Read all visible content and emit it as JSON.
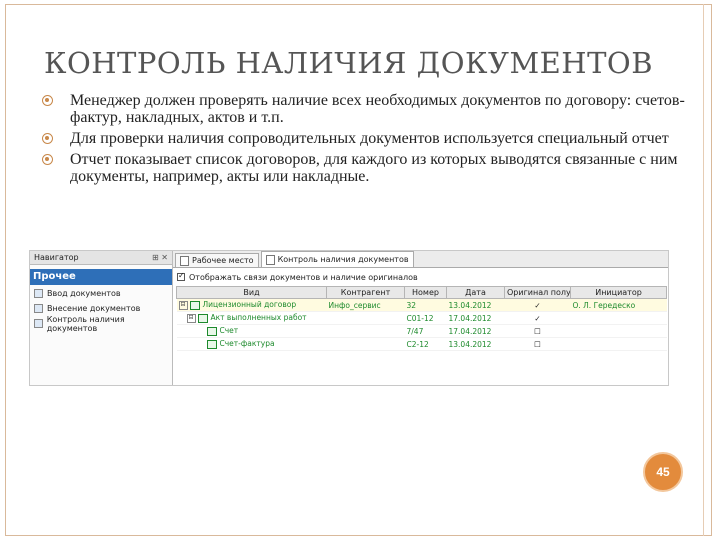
{
  "slide": {
    "title": "КОНТРОЛЬ НАЛИЧИЯ ДОКУМЕНТОВ",
    "bullets": [
      "Менеджер должен проверять наличие всех необходимых документов по договору: счетов-фактур, накладных, актов и т.п.",
      "Для проверки наличия сопроводительных документов используется специальный отчет",
      "Отчет показывает список договоров, для каждого из которых выводятся связанные с ним документы, например, акты или накладные."
    ],
    "page_number": "45",
    "accent_color": "#e38b3c"
  },
  "screenshot": {
    "nav_title": "Навигатор",
    "nav_pin": "⊞ ✕",
    "nav_group": "Прочее",
    "nav_items": [
      "Ввод документов",
      "Внесение документов",
      "Контроль наличия документов"
    ],
    "tabs": [
      "Рабочее место",
      "Контроль наличия документов"
    ],
    "filter_label": "Отображать связи документов и наличие оригиналов",
    "columns": [
      "Вид",
      "Контрагент",
      "Номер",
      "Дата",
      "Оригинал получен",
      "Инициатор"
    ],
    "rows": [
      {
        "expander": "⊟",
        "kind": "Лицензионный договор",
        "counterparty": "Инфо_сервис",
        "number": "32",
        "date": "13.04.2012",
        "original": "✓",
        "initiator": "О. Л. Гередеско"
      },
      {
        "expander": "⊟",
        "kind": "Акт выполненных работ",
        "counterparty": "",
        "number": "С01-12",
        "date": "17.04.2012",
        "original": "✓",
        "initiator": ""
      },
      {
        "expander": "",
        "kind": "Счет",
        "counterparty": "",
        "number": "7/47",
        "date": "17.04.2012",
        "original": "☐",
        "initiator": ""
      },
      {
        "expander": "",
        "kind": "Счет-фактура",
        "counterparty": "",
        "number": "С2-12",
        "date": "13.04.2012",
        "original": "☐",
        "initiator": ""
      }
    ]
  }
}
